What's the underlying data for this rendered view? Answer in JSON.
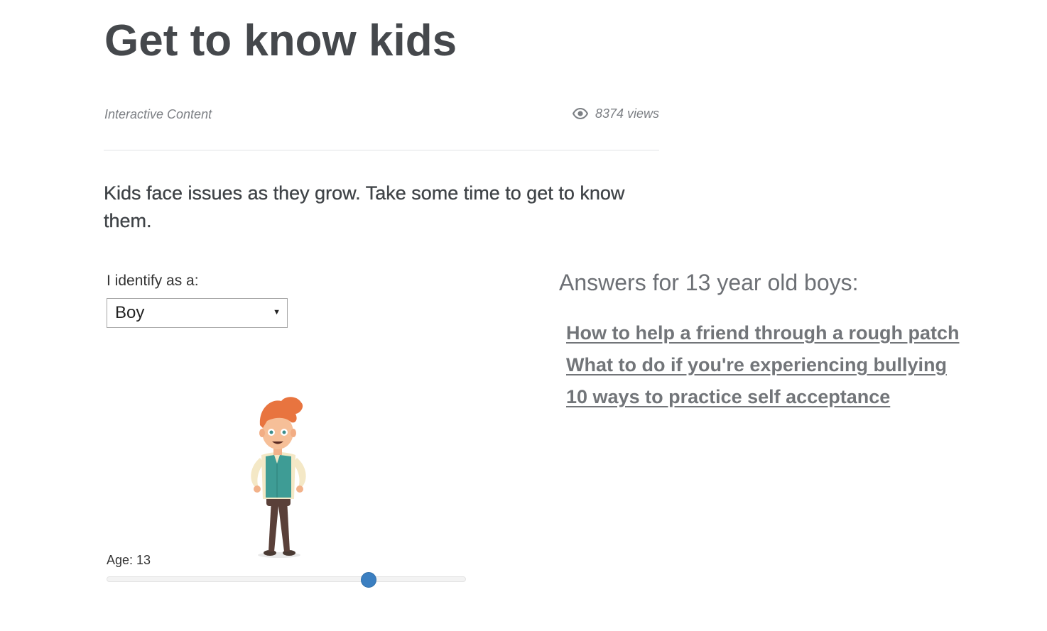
{
  "page": {
    "title": "Get to know kids",
    "content_type": "Interactive Content",
    "views": "8374 views",
    "views_icon": "eye-icon",
    "intro": "Kids face issues as they grow. Take some time to get to know them."
  },
  "form": {
    "identify_label": "I identify as a:",
    "gender_selected": "Boy",
    "age_label": "Age: 13",
    "age_value": 13,
    "age_slider_fraction": 0.73,
    "slider_accent": "#3b7fc1"
  },
  "answers": {
    "heading": "Answers for 13 year old boys:",
    "links": [
      "How to help a friend through a rough patch",
      "What to do if you're experiencing bullying",
      "10 ways to practice self acceptance"
    ]
  }
}
